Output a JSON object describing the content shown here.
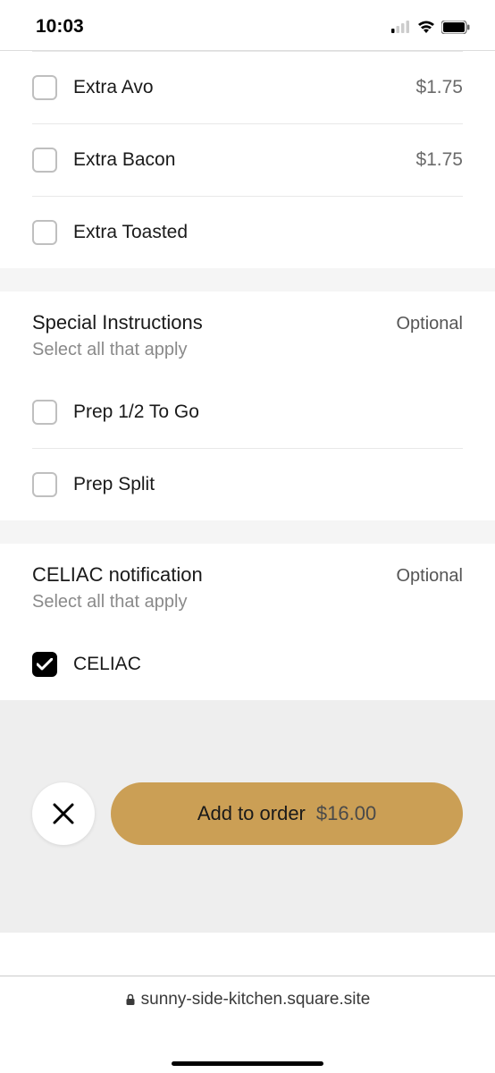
{
  "status": {
    "time": "10:03"
  },
  "extras": {
    "items": [
      {
        "label": "Extra Avo",
        "price": "$1.75",
        "checked": false
      },
      {
        "label": "Extra Bacon",
        "price": "$1.75",
        "checked": false
      },
      {
        "label": "Extra Toasted",
        "price": "",
        "checked": false
      }
    ]
  },
  "special_instructions": {
    "title": "Special Instructions",
    "optional": "Optional",
    "subtitle": "Select all that apply",
    "items": [
      {
        "label": "Prep 1/2 To Go",
        "checked": false
      },
      {
        "label": "Prep Split",
        "checked": false
      }
    ]
  },
  "celiac": {
    "title": "CELIAC notification",
    "optional": "Optional",
    "subtitle": "Select all that apply",
    "items": [
      {
        "label": "CELIAC",
        "checked": true
      }
    ]
  },
  "action": {
    "add_label": "Add to order",
    "price": "$16.00"
  },
  "url": "sunny-side-kitchen.square.site"
}
